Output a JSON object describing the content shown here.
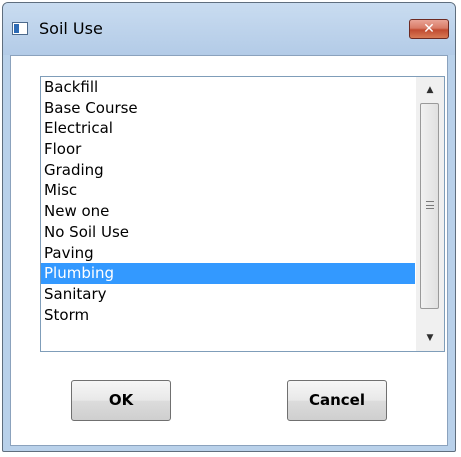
{
  "window": {
    "title": "Soil Use",
    "close_glyph": "✕"
  },
  "listbox": {
    "items": [
      "Backfill",
      "Base Course",
      "Electrical",
      "Floor",
      "Grading",
      "Misc",
      "New one",
      "No Soil Use",
      "Paving",
      "Plumbing",
      "Sanitary",
      "Storm"
    ],
    "selected_item": "Plumbing",
    "scroll_up_glyph": "▲",
    "scroll_down_glyph": "▼"
  },
  "buttons": {
    "ok_label": "OK",
    "cancel_label": "Cancel"
  },
  "icons": {
    "app": "window-app-icon",
    "close": "close-icon",
    "scroll_up": "scroll-up-arrow-icon",
    "scroll_down": "scroll-down-arrow-icon"
  },
  "colors": {
    "selection": "#3399ff",
    "close_button": "#c14a30",
    "titlebar": "#b9d1ea"
  }
}
